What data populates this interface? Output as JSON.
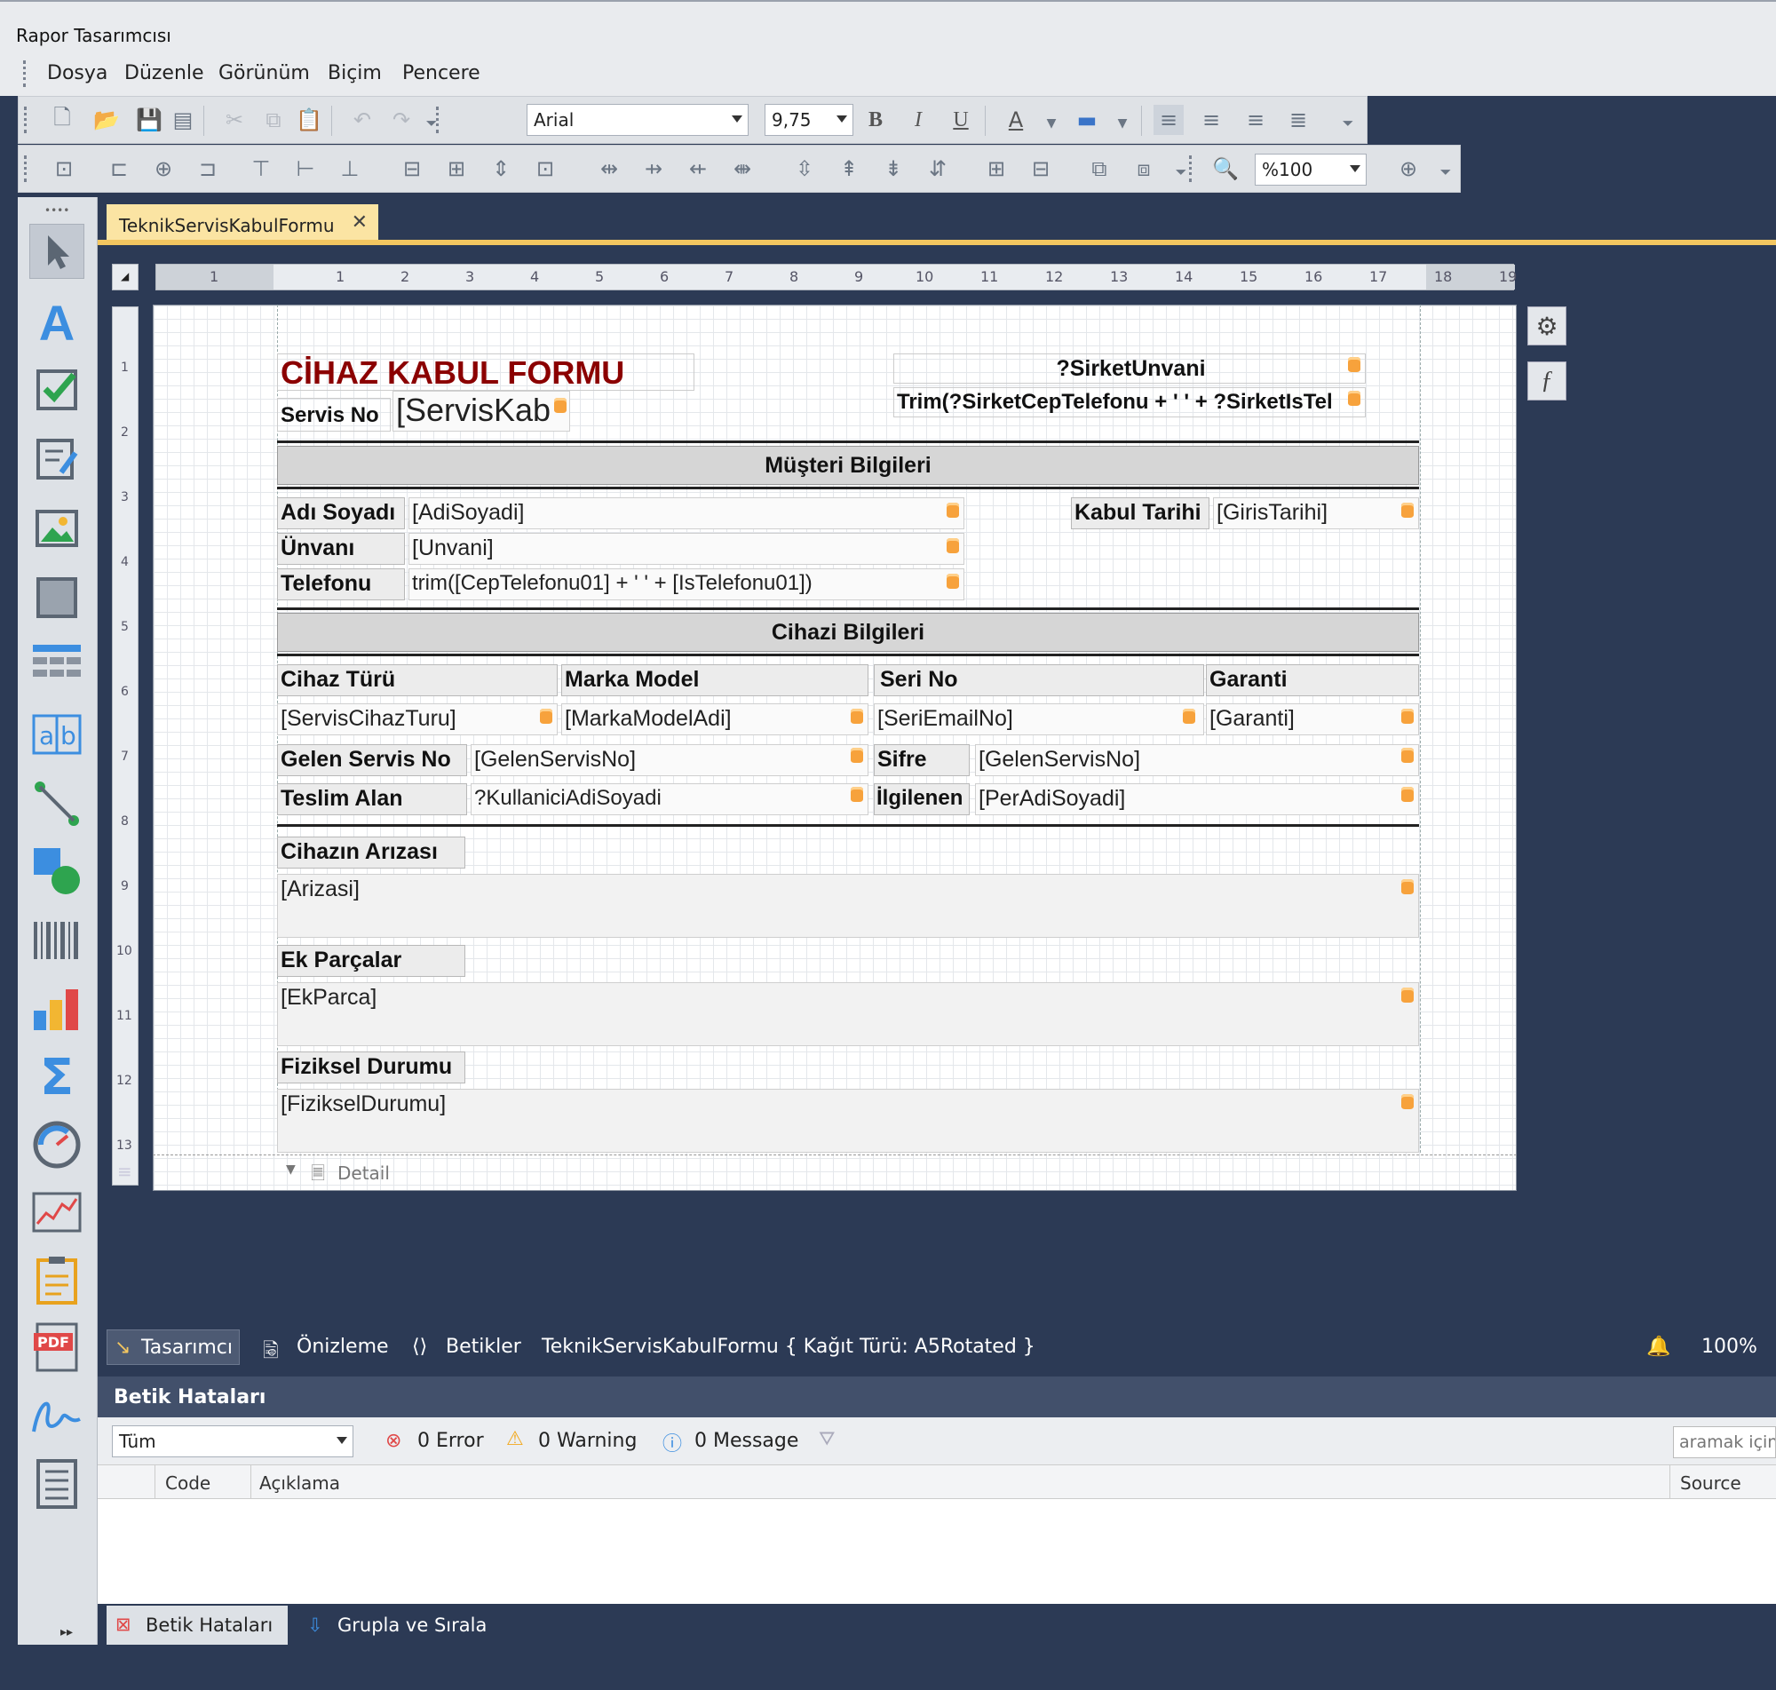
{
  "window": {
    "title": "Rapor Tasarımcısı"
  },
  "menu": [
    "Dosya",
    "Düzenle",
    "Görünüm",
    "Biçim",
    "Pencere"
  ],
  "toolbar": {
    "font": "Arial",
    "font_size": "9,75",
    "zoom": "%100"
  },
  "doc_tab": {
    "label": "TeknikServisKabulFormu"
  },
  "ruler": {
    "h": [
      "1",
      "1",
      "2",
      "3",
      "4",
      "5",
      "6",
      "7",
      "8",
      "9",
      "10",
      "11",
      "12",
      "13",
      "14",
      "15",
      "16",
      "17",
      "18",
      "19"
    ],
    "v": [
      "1",
      "2",
      "3",
      "4",
      "5",
      "6",
      "7",
      "8",
      "9",
      "10",
      "11",
      "12",
      "13"
    ]
  },
  "report": {
    "title": "CİHAZ KABUL FORMU",
    "servis_no_label": "Servis No",
    "servis_no_field": "[ServisKab",
    "sirket_unvani": "?SirketUnvani",
    "sirket_tel": "Trim(?SirketCepTelefonu + ' ' + ?SirketIsTel",
    "musteri_header": "Müşteri Bilgileri",
    "adi_soyadi_label": "Adı Soyadı",
    "adi_soyadi_field": "[AdiSoyadi]",
    "unvani_label": "Ünvanı",
    "unvani_field": "[Unvani]",
    "telefonu_label": "Telefonu",
    "telefonu_field": "trim([CepTelefonu01] + ' ' + [IsTelefonu01])",
    "kabul_tarihi_label": "Kabul Tarihi",
    "kabul_tarihi_field": "[GirisTarihi]",
    "cihaz_header": "Cihazi Bilgileri",
    "cihaz_turu_label": "Cihaz Türü",
    "marka_model_label": "Marka Model",
    "seri_no_label": "Seri No",
    "garanti_label": "Garanti",
    "cihaz_turu_field": "[ServisCihazTuru]",
    "marka_model_field": "[MarkaModelAdi]",
    "seri_no_field": "[SeriEmailNo]",
    "garanti_field": "[Garanti]",
    "gelen_servis_label": "Gelen Servis No",
    "gelen_servis_field": "[GelenServisNo]",
    "sifre_label": "Sifre",
    "sifre_field": "[GelenServisNo]",
    "teslim_alan_label": "Teslim Alan",
    "teslim_alan_field": "?KullaniciAdiSoyadi",
    "ilgilenen_label": "İlgilenen",
    "ilgilenen_field": "[PerAdiSoyadi]",
    "ariza_label": "Cihazın Arızası",
    "ariza_field": "[Arizasi]",
    "ek_parcalar_label": "Ek Parçalar",
    "ek_parcalar_field": "[EkParca]",
    "fiziksel_label": "Fiziksel Durumu",
    "fiziksel_field": "[FizikselDurumu]",
    "band_label": "Detail"
  },
  "bottom": {
    "designer": "Tasarımcı",
    "preview": "Önizleme",
    "scripts": "Betikler",
    "doc_info": "TeknikServisKabulFormu { Kağıt Türü: A5Rotated }",
    "zoom": "100%"
  },
  "errors": {
    "title": "Betik Hataları",
    "filter": "Tüm",
    "error_count": "0 Error",
    "warning_count": "0 Warning",
    "message_count": "0 Message",
    "search_placeholder": "aramak için",
    "col_code": "Code",
    "col_desc": "Açıklama",
    "col_source": "Source"
  },
  "panel_tabs": {
    "errors": "Betik Hataları",
    "group_sort": "Grupla ve Sırala"
  },
  "colors": {
    "accent": "#f3c660",
    "title_red": "#8b0000",
    "dark_bg": "#2c3a55"
  }
}
